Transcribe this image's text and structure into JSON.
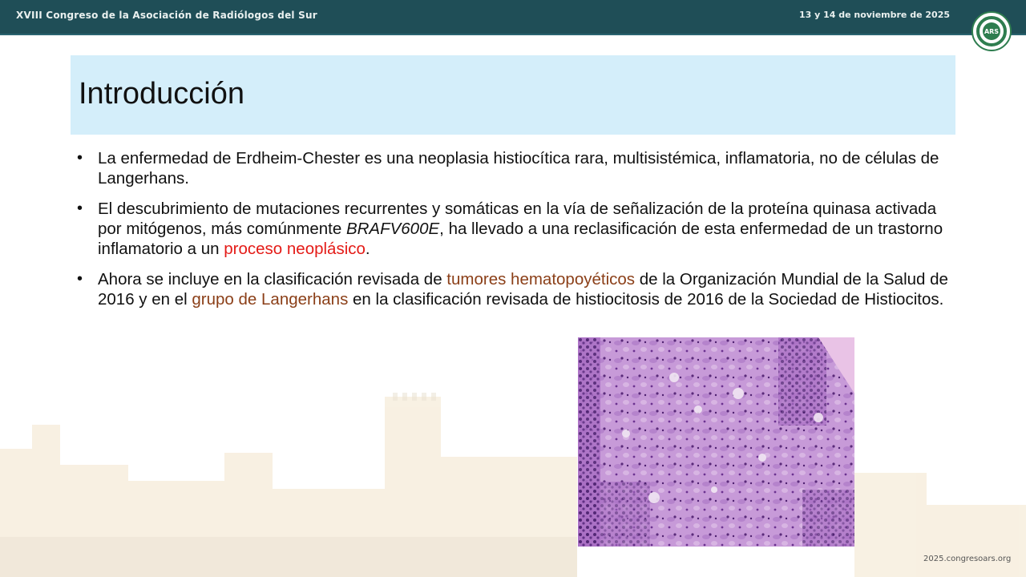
{
  "header": {
    "congress_title": "XVIII Congreso de la Asociación de Radiólogos del Sur",
    "dates": "13 y 14 de noviembre de 2025",
    "logo_text": "ARS",
    "brand_color": "#1f4e57"
  },
  "slide": {
    "title": "Introducción",
    "title_background": "#d4eefa",
    "bullets": [
      {
        "parts": [
          {
            "text": "La enfermedad de Erdheim-Chester es una neoplasia histiocítica rara, multisistémica, inflamatoria, no de células de Langerhans."
          }
        ]
      },
      {
        "parts": [
          {
            "text": "El descubrimiento de mutaciones recurrentes y somáticas en la vía de señalización de la proteína quinasa activada por mitógenos, más comúnmente "
          },
          {
            "text": "BRAFV600E",
            "style": "italic"
          },
          {
            "text": ", ha llevado a una reclasificación de esta enfermedad de un trastorno inflamatorio a un "
          },
          {
            "text": "proceso neoplásico",
            "style": "red"
          },
          {
            "text": "."
          }
        ]
      },
      {
        "parts": [
          {
            "text": "Ahora se incluye en la clasificación revisada de "
          },
          {
            "text": "tumores hematopoyéticos",
            "style": "brown"
          },
          {
            "text": " de la Organización Mundial de la Salud de 2016 y en el "
          },
          {
            "text": "grupo de Langerhans",
            "style": "brown"
          },
          {
            "text": " en la clasificación revisada de histiocitosis de 2016 de la Sociedad de Histiocitos."
          }
        ]
      }
    ],
    "highlight_colors": {
      "red": "#e41b17",
      "brown": "#8b3f18"
    }
  },
  "footer": {
    "url": "2025.congresoars.org"
  }
}
